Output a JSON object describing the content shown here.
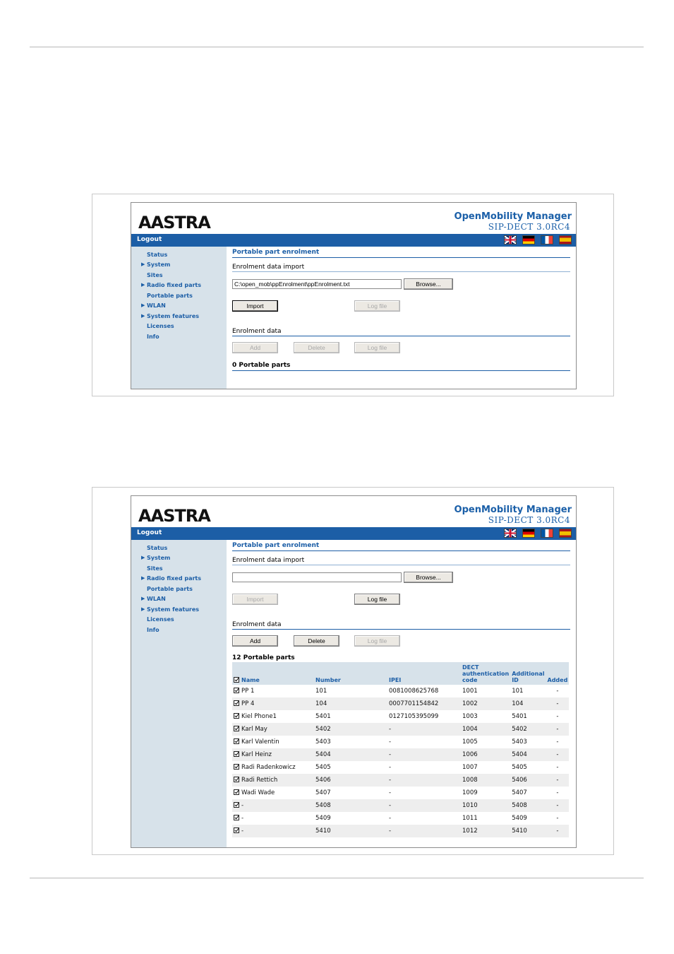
{
  "brand": {
    "logo_text": "AASTRA",
    "product_title": "OpenMobility Manager",
    "product_version": "SIP-DECT 3.0RC4"
  },
  "topbar": {
    "logout_label": "Logout",
    "flags": [
      "english-flag",
      "german-flag",
      "french-flag",
      "spanish-flag"
    ]
  },
  "sidebar": {
    "items": [
      {
        "label": "Status",
        "arrow": false
      },
      {
        "label": "System",
        "arrow": true
      },
      {
        "label": "Sites",
        "arrow": false
      },
      {
        "label": "Radio fixed parts",
        "arrow": true
      },
      {
        "label": "Portable parts",
        "arrow": false
      },
      {
        "label": "WLAN",
        "arrow": true
      },
      {
        "label": "System features",
        "arrow": true
      },
      {
        "label": "Licenses",
        "arrow": false
      },
      {
        "label": "Info",
        "arrow": false
      }
    ]
  },
  "screen1": {
    "page_title": "Portable part enrolment",
    "import_section": "Enrolment data import",
    "file_value": "C:\\open_mob\\ppEnrolment\\ppEnrolment.txt",
    "browse_label": "Browse...",
    "import_label": "Import",
    "logfile_label": "Log file",
    "data_section": "Enrolment data",
    "add_label": "Add",
    "delete_label": "Delete",
    "logfile2_label": "Log file",
    "count_label": "0 Portable parts"
  },
  "screen2": {
    "page_title": "Portable part enrolment",
    "import_section": "Enrolment data import",
    "file_value": "",
    "browse_label": "Browse...",
    "import_label": "Import",
    "logfile_label": "Log file",
    "data_section": "Enrolment data",
    "add_label": "Add",
    "delete_label": "Delete",
    "logfile2_label": "Log file",
    "count_label": "12 Portable parts",
    "table": {
      "headers": {
        "name": "Name",
        "number": "Number",
        "ipei": "IPEI",
        "dect_auth": "DECT authentication code",
        "additional_id": "Additional ID",
        "added": "Added"
      },
      "rows": [
        {
          "name": "PP 1",
          "number": "101",
          "ipei": "0081008625768",
          "dect": "1001",
          "addid": "101",
          "added": "-"
        },
        {
          "name": "PP 4",
          "number": "104",
          "ipei": "0007701154842",
          "dect": "1002",
          "addid": "104",
          "added": "-"
        },
        {
          "name": "Kiel Phone1",
          "number": "5401",
          "ipei": "0127105395099",
          "dect": "1003",
          "addid": "5401",
          "added": "-"
        },
        {
          "name": "Karl May",
          "number": "5402",
          "ipei": "-",
          "dect": "1004",
          "addid": "5402",
          "added": "-"
        },
        {
          "name": "Karl Valentin",
          "number": "5403",
          "ipei": "-",
          "dect": "1005",
          "addid": "5403",
          "added": "-"
        },
        {
          "name": "Karl Heinz",
          "number": "5404",
          "ipei": "-",
          "dect": "1006",
          "addid": "5404",
          "added": "-"
        },
        {
          "name": "Radi Radenkowicz",
          "number": "5405",
          "ipei": "-",
          "dect": "1007",
          "addid": "5405",
          "added": "-"
        },
        {
          "name": "Radi Rettich",
          "number": "5406",
          "ipei": "-",
          "dect": "1008",
          "addid": "5406",
          "added": "-"
        },
        {
          "name": "Wadi Wade",
          "number": "5407",
          "ipei": "-",
          "dect": "1009",
          "addid": "5407",
          "added": "-"
        },
        {
          "name": "-",
          "number": "5408",
          "ipei": "-",
          "dect": "1010",
          "addid": "5408",
          "added": "-"
        },
        {
          "name": "-",
          "number": "5409",
          "ipei": "-",
          "dect": "1011",
          "addid": "5409",
          "added": "-"
        },
        {
          "name": "-",
          "number": "5410",
          "ipei": "-",
          "dect": "1012",
          "addid": "5410",
          "added": "-"
        }
      ]
    }
  },
  "colors": {
    "accent": "#1c5ea6",
    "sidebar_bg": "#d7e2ea"
  }
}
